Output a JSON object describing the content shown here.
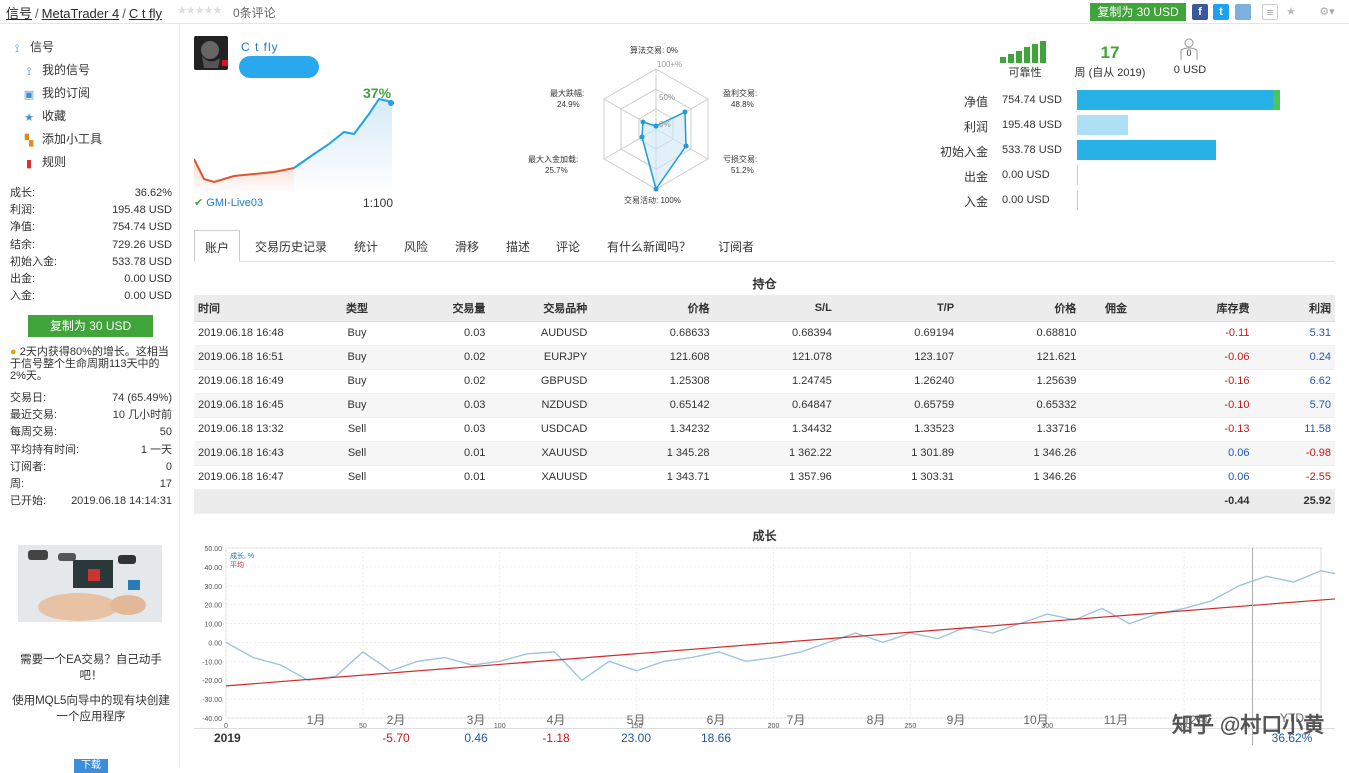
{
  "breadcrumb": {
    "signals": "信号",
    "platform": "MetaTrader 4",
    "name": "C t fly"
  },
  "stars": "★★★★★",
  "reviews": "0条评论",
  "top_copy": "复制为 30 USD",
  "social": {
    "fb": "f",
    "tw": "t"
  },
  "menu": {
    "head": "信号",
    "items": [
      "我的信号",
      "我的订阅",
      "收藏",
      "添加小工具",
      "规则"
    ]
  },
  "stats1": [
    [
      "成长:",
      "36.62%"
    ],
    [
      "利润:",
      "195.48 USD"
    ],
    [
      "净值:",
      "754.74 USD"
    ],
    [
      "结余:",
      "729.26 USD"
    ],
    [
      "初始入金:",
      "533.78 USD"
    ],
    [
      "出金:",
      "0.00 USD"
    ],
    [
      "入金:",
      "0.00 USD"
    ]
  ],
  "side_copy": "复制为 30 USD",
  "note": "2天内获得80%的增长。这相当于信号整个生命周期113天中的2%天。",
  "stats2": [
    [
      "交易日:",
      "74 (65.49%)"
    ],
    [
      "最近交易:",
      "10 几小时前"
    ],
    [
      "每周交易:",
      "50"
    ],
    [
      "平均持有时间:",
      "1 一天"
    ],
    [
      "订阅者:",
      "0"
    ],
    [
      "周:",
      "17"
    ],
    [
      "已开始:",
      "2019.06.18 14:14:31"
    ]
  ],
  "ad": {
    "line1": "需要一个EA交易？自己动手吧！",
    "line2": "使用MQL5向导中的现有块创建一个应用程序",
    "btn": "下载"
  },
  "signal": {
    "name": "C t fly",
    "growth": "37%",
    "broker": "GMI-Live03",
    "leverage": "1:100"
  },
  "radar": {
    "labels": [
      "算法交易: 0%",
      "盈利交易:",
      "48.8%",
      "亏损交易:",
      "51.2%",
      "交易活动: 100%",
      "最大入金加载:",
      "25.7%",
      "最大跌幅:",
      "24.9%",
      "100+%",
      "50%",
      "0%"
    ]
  },
  "kpi": {
    "reliability": "可靠性",
    "weeks": "17",
    "weeks_label": "周 (自从 2019)",
    "subs": "0",
    "subs_label": "0 USD"
  },
  "bars": [
    {
      "label": "净值",
      "value": "754.74 USD",
      "fill": 1.0,
      "color": "#27b1e6"
    },
    {
      "label": "利润",
      "value": "195.48 USD",
      "fill": 0.26,
      "color": "#aee0f5"
    },
    {
      "label": "初始入金",
      "value": "533.78 USD",
      "fill": 0.71,
      "color": "#27b1e6"
    },
    {
      "label": "出金",
      "value": "0.00 USD",
      "fill": 0,
      "color": "#27b1e6"
    },
    {
      "label": "入金",
      "value": "0.00 USD",
      "fill": 0,
      "color": "#27b1e6"
    }
  ],
  "tabs": [
    "账户",
    "交易历史记录",
    "统计",
    "风险",
    "滑移",
    "描述",
    "评论",
    "有什么新闻吗？",
    "订阅者"
  ],
  "positions_title": "持仓",
  "pos_headers": [
    "时间",
    "类型",
    "交易量",
    "交易品种",
    "价格",
    "S/L",
    "T/P",
    "价格",
    "佣金",
    "库存费",
    "利润"
  ],
  "positions": [
    [
      "2019.06.18 16:48",
      "Buy",
      "0.03",
      "AUDUSD",
      "0.68633",
      "0.68394",
      "0.69194",
      "0.68810",
      "",
      "-0.11",
      "5.31"
    ],
    [
      "2019.06.18 16:51",
      "Buy",
      "0.02",
      "EURJPY",
      "121.608",
      "121.078",
      "123.107",
      "121.621",
      "",
      "-0.06",
      "0.24"
    ],
    [
      "2019.06.18 16:49",
      "Buy",
      "0.02",
      "GBPUSD",
      "1.25308",
      "1.24745",
      "1.26240",
      "1.25639",
      "",
      "-0.16",
      "6.62"
    ],
    [
      "2019.06.18 16:45",
      "Buy",
      "0.03",
      "NZDUSD",
      "0.65142",
      "0.64847",
      "0.65759",
      "0.65332",
      "",
      "-0.10",
      "5.70"
    ],
    [
      "2019.06.18 13:32",
      "Sell",
      "0.03",
      "USDCAD",
      "1.34232",
      "1.34432",
      "1.33523",
      "1.33716",
      "",
      "-0.13",
      "11.58"
    ],
    [
      "2019.06.18 16:43",
      "Sell",
      "0.01",
      "XAUUSD",
      "1 345.28",
      "1 362.22",
      "1 301.89",
      "1 346.26",
      "",
      "0.06",
      "-0.98"
    ],
    [
      "2019.06.18 16:47",
      "Sell",
      "0.01",
      "XAUUSD",
      "1 343.71",
      "1 357.96",
      "1 303.31",
      "1 346.26",
      "",
      "0.06",
      "-2.55"
    ]
  ],
  "pos_total": {
    "swap": "-0.44",
    "profit": "25.92"
  },
  "growth_title": "成长",
  "chart_data": {
    "type": "line",
    "title": "成长",
    "legend": [
      "成长, %",
      "平均"
    ],
    "xlim": [
      0,
      400
    ],
    "ylim": [
      -40,
      50
    ],
    "yticks": [
      "50.00",
      "40.00",
      "30.00",
      "20.00",
      "10.00",
      "0.00",
      "-10.00",
      "-20.00",
      "-30.00",
      "-40.00"
    ],
    "xticks": [
      "0",
      "50",
      "100",
      "150",
      "200",
      "250",
      "300",
      "350"
    ],
    "growth_x": [
      0,
      10,
      20,
      30,
      40,
      50,
      60,
      70,
      80,
      90,
      100,
      110,
      120,
      130,
      140,
      150,
      160,
      170,
      180,
      190,
      200,
      210,
      220,
      230,
      240,
      250,
      260,
      270,
      280,
      290,
      300,
      310,
      320,
      330,
      340,
      350,
      360,
      370,
      380,
      390,
      400,
      410,
      420,
      440
    ],
    "growth_y": [
      0,
      -8,
      -12,
      -20,
      -18,
      -5,
      -15,
      -10,
      -8,
      -12,
      -10,
      -6,
      -5,
      -20,
      -10,
      -15,
      -10,
      -8,
      -5,
      -10,
      -8,
      -5,
      0,
      5,
      0,
      5,
      2,
      8,
      5,
      10,
      15,
      12,
      18,
      10,
      15,
      18,
      22,
      30,
      35,
      32,
      38,
      35,
      35,
      36
    ],
    "avg": [
      [
        0,
        -23
      ],
      [
        440,
        27
      ]
    ],
    "months": [
      "1月",
      "2月",
      "3月",
      "4月",
      "5月",
      "6月",
      "7月",
      "8月",
      "9月",
      "10月",
      "11月",
      "12月",
      "YTD"
    ],
    "year": "2019",
    "monthly": [
      "",
      "-5.70",
      "0.46",
      "-1.18",
      "23.00",
      "18.66",
      "",
      "",
      "",
      "",
      "",
      "",
      "36.62%"
    ]
  },
  "watermark": "知乎 @村口小黄"
}
